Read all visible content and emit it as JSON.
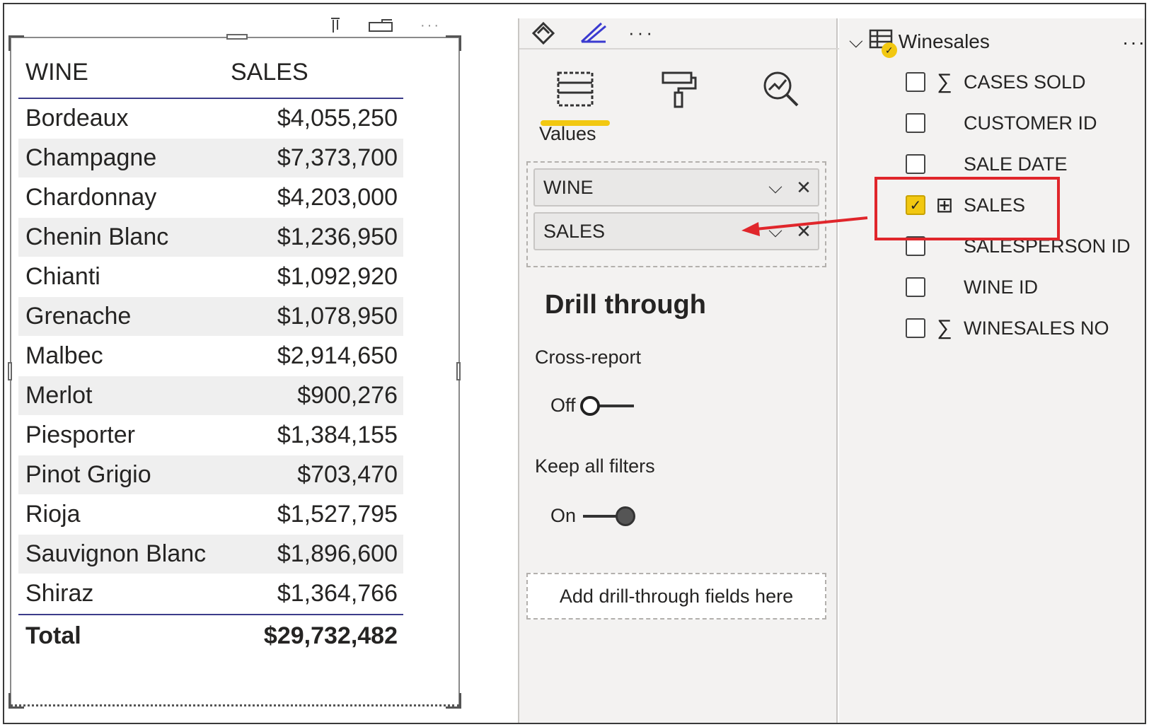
{
  "table_visual": {
    "columns": [
      "WINE",
      "SALES"
    ],
    "rows": [
      {
        "wine": "Bordeaux",
        "sales": "$4,055,250"
      },
      {
        "wine": "Champagne",
        "sales": "$7,373,700"
      },
      {
        "wine": "Chardonnay",
        "sales": "$4,203,000"
      },
      {
        "wine": "Chenin Blanc",
        "sales": "$1,236,950"
      },
      {
        "wine": "Chianti",
        "sales": "$1,092,920"
      },
      {
        "wine": "Grenache",
        "sales": "$1,078,950"
      },
      {
        "wine": "Malbec",
        "sales": "$2,914,650"
      },
      {
        "wine": "Merlot",
        "sales": "$900,276"
      },
      {
        "wine": "Piesporter",
        "sales": "$1,384,155"
      },
      {
        "wine": "Pinot Grigio",
        "sales": "$703,470"
      },
      {
        "wine": "Rioja",
        "sales": "$1,527,795"
      },
      {
        "wine": "Sauvignon Blanc",
        "sales": "$1,896,600"
      },
      {
        "wine": "Shiraz",
        "sales": "$1,364,766"
      }
    ],
    "total_label": "Total",
    "total_value": "$29,732,482"
  },
  "viz_pane": {
    "top_icons": [
      "sparkle-diamond-icon",
      "sparkle-pen-icon",
      "more-icon"
    ],
    "tabs": [
      "build-visual-icon",
      "format-paintbrush-icon",
      "analytics-icon"
    ],
    "values_label": "Values",
    "value_wells": [
      "WINE",
      "SALES"
    ],
    "drill_through_title": "Drill through",
    "cross_report_label": "Cross-report",
    "cross_report_state": "Off",
    "keep_filters_label": "Keep all filters",
    "keep_filters_state": "On",
    "drop_zone": "Add drill-through fields here"
  },
  "fields_pane": {
    "table_name": "Winesales",
    "fields": [
      {
        "name": "CASES SOLD",
        "icon": "sigma-icon",
        "checked": false
      },
      {
        "name": "CUSTOMER ID",
        "icon": "",
        "checked": false
      },
      {
        "name": "SALE DATE",
        "icon": "",
        "checked": false
      },
      {
        "name": "SALES",
        "icon": "measure-table-icon",
        "checked": true
      },
      {
        "name": "SALESPERSON ID",
        "icon": "",
        "checked": false
      },
      {
        "name": "WINE ID",
        "icon": "",
        "checked": false
      },
      {
        "name": "WINESALES NO",
        "icon": "sigma-icon",
        "checked": false
      }
    ]
  },
  "colors": {
    "accent_yellow": "#f2c811",
    "highlight_red": "#e0262b",
    "pane_bg": "#f3f2f1"
  }
}
